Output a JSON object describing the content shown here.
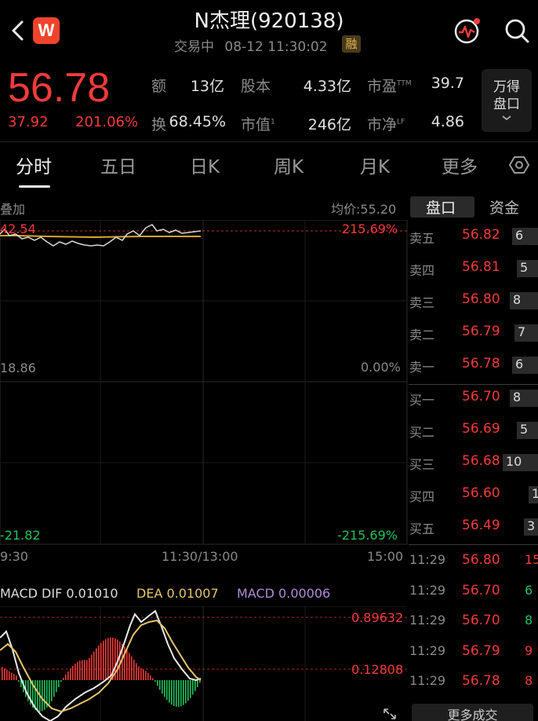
{
  "header": {
    "title": "N杰理(920138)",
    "status": "交易中",
    "datetime": "08-12 11:30:02",
    "margin_badge": "融",
    "logo_letter": "W"
  },
  "quote": {
    "price": "56.78",
    "change": "37.92",
    "change_pct": "201.06%",
    "stats": [
      {
        "label": "额",
        "value": "13亿"
      },
      {
        "label": "股本",
        "value": "4.33亿"
      },
      {
        "label": "市盈",
        "sup": "TTM",
        "value": "39.7"
      },
      {
        "label": "换",
        "value": "68.45%"
      },
      {
        "label": "市值",
        "sup": "1",
        "value": "246亿"
      },
      {
        "label": "市净",
        "sup": "LF",
        "value": "4.86"
      }
    ],
    "wande_button": {
      "line1": "万得",
      "line2": "盘口"
    }
  },
  "tabs": [
    "分时",
    "五日",
    "日K",
    "周K",
    "月K",
    "更多"
  ],
  "intraday": {
    "overlay_label": "叠加",
    "avg_price_label": "均价:55.20",
    "top_left": "42.54",
    "top_right": "215.69%",
    "mid_left": "18.86",
    "mid_right": "0.00%",
    "bottom_left": "-21.82",
    "bottom_right": "-215.69%",
    "time_start": "9:30",
    "time_mid": "11:30/13:00",
    "time_end": "15:00"
  },
  "macd": {
    "dif": "MACD DIF 0.01010",
    "dea": "DEA 0.01007",
    "macd": "MACD 0.00006",
    "top_value": "0.89632",
    "mid_value": "0.12808"
  },
  "side_tabs": [
    "盘口",
    "资金"
  ],
  "order_book": {
    "asks": [
      {
        "label": "卖五",
        "price": "56.82",
        "vol": "6",
        "bar": 0.55
      },
      {
        "label": "卖四",
        "price": "56.81",
        "vol": "5",
        "bar": 0.45
      },
      {
        "label": "卖三",
        "price": "56.80",
        "vol": "8",
        "bar": 0.6
      },
      {
        "label": "卖二",
        "price": "56.79",
        "vol": "7",
        "bar": 0.5
      },
      {
        "label": "卖一",
        "price": "56.78",
        "vol": "6",
        "bar": 0.55
      }
    ],
    "bids": [
      {
        "label": "买一",
        "price": "56.70",
        "vol": "8",
        "bar": 0.6
      },
      {
        "label": "买二",
        "price": "56.69",
        "vol": "5",
        "bar": 0.45
      },
      {
        "label": "买三",
        "price": "56.68",
        "vol": "10",
        "bar": 0.75
      },
      {
        "label": "买四",
        "price": "56.60",
        "vol": "1",
        "bar": 0.2
      },
      {
        "label": "买五",
        "price": "56.49",
        "vol": "3",
        "bar": 0.3
      }
    ]
  },
  "trades": [
    {
      "time": "11:29",
      "price": "56.80",
      "vol": "15",
      "color": "red"
    },
    {
      "time": "11:29",
      "price": "56.70",
      "vol": "6",
      "color": "green"
    },
    {
      "time": "11:29",
      "price": "56.70",
      "vol": "8",
      "color": "green"
    },
    {
      "time": "11:29",
      "price": "56.79",
      "vol": "9",
      "color": "red"
    },
    {
      "time": "11:29",
      "price": "56.78",
      "vol": "8",
      "color": "red"
    }
  ],
  "more_trades_label": "更多成交",
  "colors": {
    "up": "#f23b3b",
    "down": "#22c35e",
    "avg_line": "#e0a42a",
    "price_line": "#d8d8d8",
    "dea_line": "#e7c56b",
    "macd_text": "#b18bd8"
  }
}
